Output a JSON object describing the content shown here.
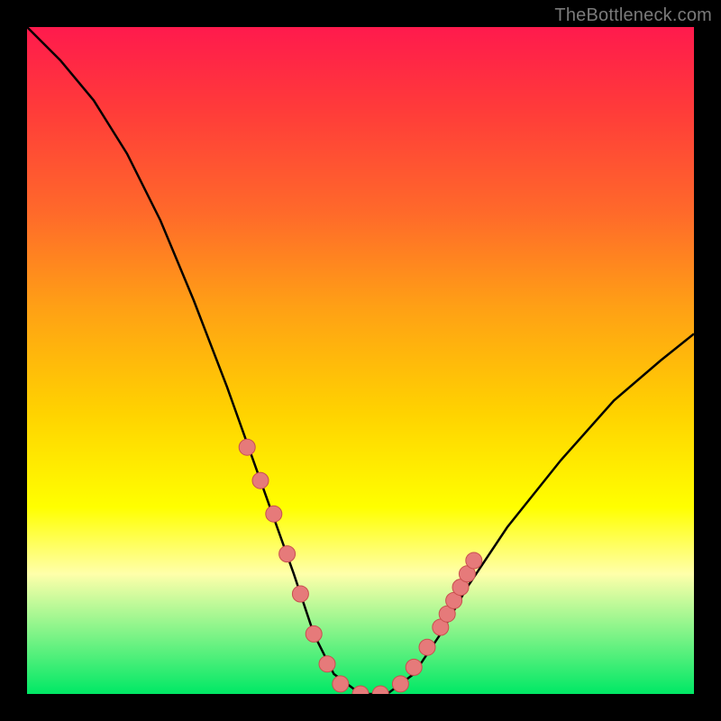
{
  "watermark": "TheBottleneck.com",
  "colors": {
    "frame": "#000000",
    "curve": "#000000",
    "marker_fill": "#e67a7a",
    "marker_stroke": "#c94f4f"
  },
  "chart_data": {
    "type": "line",
    "title": "",
    "xlabel": "",
    "ylabel": "",
    "xlim": [
      0,
      100
    ],
    "ylim": [
      0,
      100
    ],
    "note": "Axes are unlabeled; values estimated from plot position. y=0 at bottom (green), y=100 at top (red).",
    "series": [
      {
        "name": "curve",
        "x": [
          0,
          5,
          10,
          15,
          20,
          25,
          30,
          35,
          40,
          43,
          46,
          50,
          54,
          58,
          62,
          66,
          72,
          80,
          88,
          95,
          100
        ],
        "values": [
          100,
          95,
          89,
          81,
          71,
          59,
          46,
          32,
          18,
          9,
          3,
          0,
          0,
          3,
          9,
          16,
          25,
          35,
          44,
          50,
          54
        ]
      }
    ],
    "markers": {
      "name": "highlighted-points",
      "x": [
        33,
        35,
        37,
        39,
        41,
        43,
        45,
        47,
        50,
        53,
        56,
        58,
        60,
        62,
        63,
        64,
        65,
        66,
        67
      ],
      "values": [
        37,
        32,
        27,
        21,
        15,
        9,
        4.5,
        1.5,
        0,
        0,
        1.5,
        4,
        7,
        10,
        12,
        14,
        16,
        18,
        20
      ]
    }
  }
}
